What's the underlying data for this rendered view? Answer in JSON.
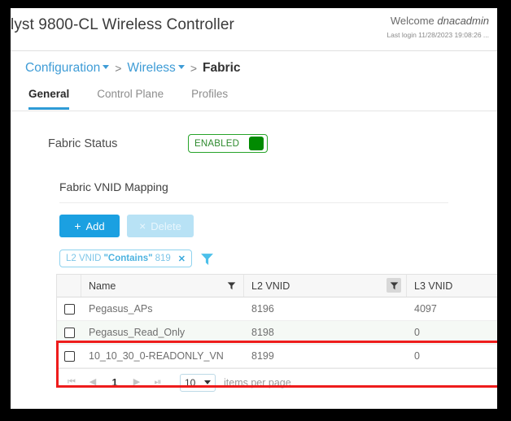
{
  "header": {
    "app_title": "lyst 9800-CL Wireless Controller",
    "welcome_prefix": "Welcome",
    "welcome_user": "dnacadmin",
    "last_login": "Last login 11/28/2023 19:08:26 ..."
  },
  "breadcrumb": {
    "items": [
      {
        "label": "Configuration",
        "has_caret": true
      },
      {
        "label": "Wireless",
        "has_caret": true
      },
      {
        "label": "Fabric",
        "has_caret": false
      }
    ],
    "separator": ">"
  },
  "tabs": [
    {
      "label": "General",
      "active": true
    },
    {
      "label": "Control Plane",
      "active": false
    },
    {
      "label": "Profiles",
      "active": false
    }
  ],
  "fabric_status": {
    "label": "Fabric Status",
    "toggle_text": "ENABLED",
    "accent_color": "#27a329"
  },
  "vnid_section": {
    "title": "Fabric VNID Mapping",
    "add_label": "Add",
    "add_glyph": "+",
    "delete_label": "Delete",
    "delete_glyph": "×",
    "add_color": "#1ba0e1",
    "delete_color": "#b8e2f5"
  },
  "filter_chip": {
    "field": "L2 VNID",
    "operator": "\"Contains\"",
    "value": "819",
    "remove_glyph": "✕"
  },
  "table": {
    "columns": [
      {
        "key": "check",
        "label": "",
        "filter": "none"
      },
      {
        "key": "name",
        "label": "Name",
        "filter": "idle"
      },
      {
        "key": "l2",
        "label": "L2 VNID",
        "filter": "active"
      },
      {
        "key": "l3",
        "label": "L3 VNID",
        "filter": "none"
      }
    ],
    "rows": [
      {
        "name": "Pegasus_APs",
        "l2": "8196",
        "l3": "4097",
        "checked": false,
        "highlighted": false
      },
      {
        "name": "Pegasus_Read_Only",
        "l2": "8198",
        "l3": "0",
        "checked": false,
        "highlighted": true
      },
      {
        "name": "10_10_30_0-READONLY_VN",
        "l2": "8199",
        "l3": "0",
        "checked": false,
        "highlighted": true
      }
    ]
  },
  "highlight": {
    "color": "#ee1c1c"
  },
  "pager": {
    "first_glyph": "⏮",
    "prev_glyph": "◀",
    "page": "1",
    "next_glyph": "▶",
    "last_glyph": "⏭",
    "page_size": "10",
    "items_per_page_label": "items per page"
  }
}
